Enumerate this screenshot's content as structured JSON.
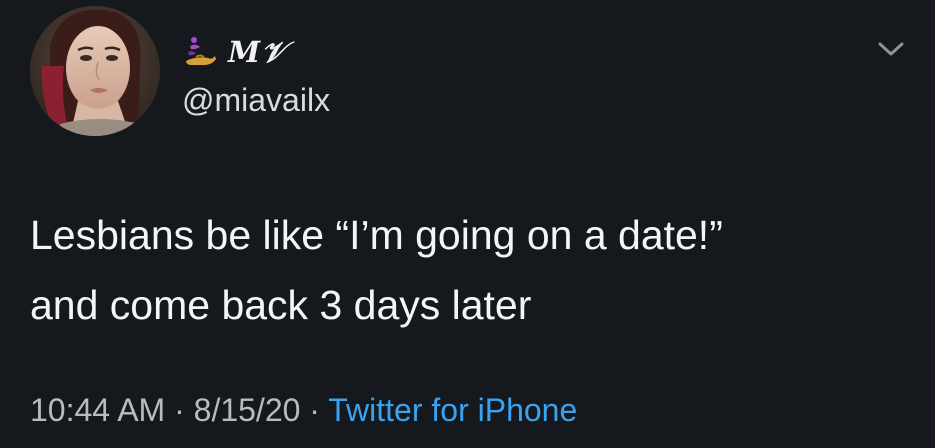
{
  "author": {
    "display_name": "M𝒱",
    "display_name_prefix_icon": "genie-lamp-emoji-icon",
    "handle": "@miavailx",
    "avatar_icon": "profile-photo-avatar"
  },
  "tweet": {
    "line1": "Lesbians be like “I’m going on a date!”",
    "line2": "and come back 3 days later"
  },
  "meta": {
    "time": "10:44 AM",
    "separator1": " · ",
    "date": "8/15/20",
    "separator2": " · ",
    "source": "Twitter for iPhone"
  },
  "icons": {
    "menu": "chevron-down-icon"
  },
  "colors": {
    "background": "#15181c",
    "text": "#f4f5f6",
    "secondary_text": "#b8bcc0",
    "link": "#3aa3ef",
    "emoji_purple": "#a34bd1"
  }
}
